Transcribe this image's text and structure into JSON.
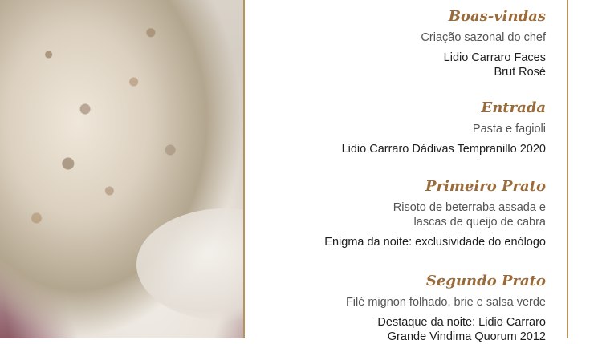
{
  "courses": [
    {
      "title": "Boas-vindas",
      "dish_lines": [
        "Criação sazonal do chef"
      ],
      "wine_lines": [
        "Lidio Carraro Faces",
        "Brut Rosé"
      ]
    },
    {
      "title": "Entrada",
      "dish_lines": [
        "Pasta e fagioli"
      ],
      "wine_lines": [
        "Lidio Carraro Dádivas Tempranillo 2020"
      ]
    },
    {
      "title": "Primeiro Prato",
      "dish_lines": [
        "Risoto de beterraba assada e",
        "lascas de queijo de cabra"
      ],
      "wine_lines": [
        "Enigma da noite: exclusividade do enólogo"
      ]
    },
    {
      "title": "Segundo Prato",
      "dish_lines": [
        "Filé mignon folhado, brie e salsa verde"
      ],
      "wine_lines": [
        "Destaque da noite: Lidio Carraro",
        "Grande Vindima Quorum 2012"
      ]
    }
  ]
}
